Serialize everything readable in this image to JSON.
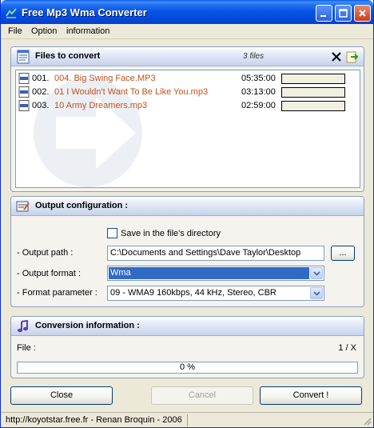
{
  "window": {
    "title": "Free Mp3 Wma Converter"
  },
  "menu": {
    "items": [
      "File",
      "Option",
      "information"
    ]
  },
  "files_panel": {
    "title": "Files to convert",
    "count": "3 files",
    "files": [
      {
        "num": "001.",
        "name": "004. Big Swing Face.MP3",
        "duration": "05:35:00"
      },
      {
        "num": "002.",
        "name": "01 I Wouldn't Want To Be Like You.mp3",
        "duration": "03:13:00"
      },
      {
        "num": "003.",
        "name": "10 Army Dreamers.mp3",
        "duration": "02:59:00"
      }
    ]
  },
  "output_panel": {
    "title": "Output configuration :",
    "save_in_dir_label": "Save in the file's directory",
    "save_in_dir_checked": false,
    "output_path_label": "- Output path :",
    "output_path_value": "C:\\Documents and Settings\\Dave Taylor\\Desktop",
    "browse_label": "...",
    "output_format_label": "- Output format :",
    "output_format_value": "Wma",
    "format_param_label": "- Format parameter :",
    "format_param_value": "09 - WMA9 160kbps, 44 kHz, Stereo, CBR"
  },
  "conversion_panel": {
    "title": "Conversion information :",
    "file_label": "File :",
    "file_counter": "1 / X",
    "progress_text": "0 %",
    "progress_value": 0
  },
  "buttons": {
    "close": "Close",
    "cancel": "Cancel",
    "convert": "Convert !"
  },
  "status": {
    "text": "http://koyotstar.free.fr - Renan Broquin - 2006"
  },
  "colors": {
    "accent": "#0553e6",
    "file_name": "#c0501e",
    "selection": "#316ac5"
  }
}
